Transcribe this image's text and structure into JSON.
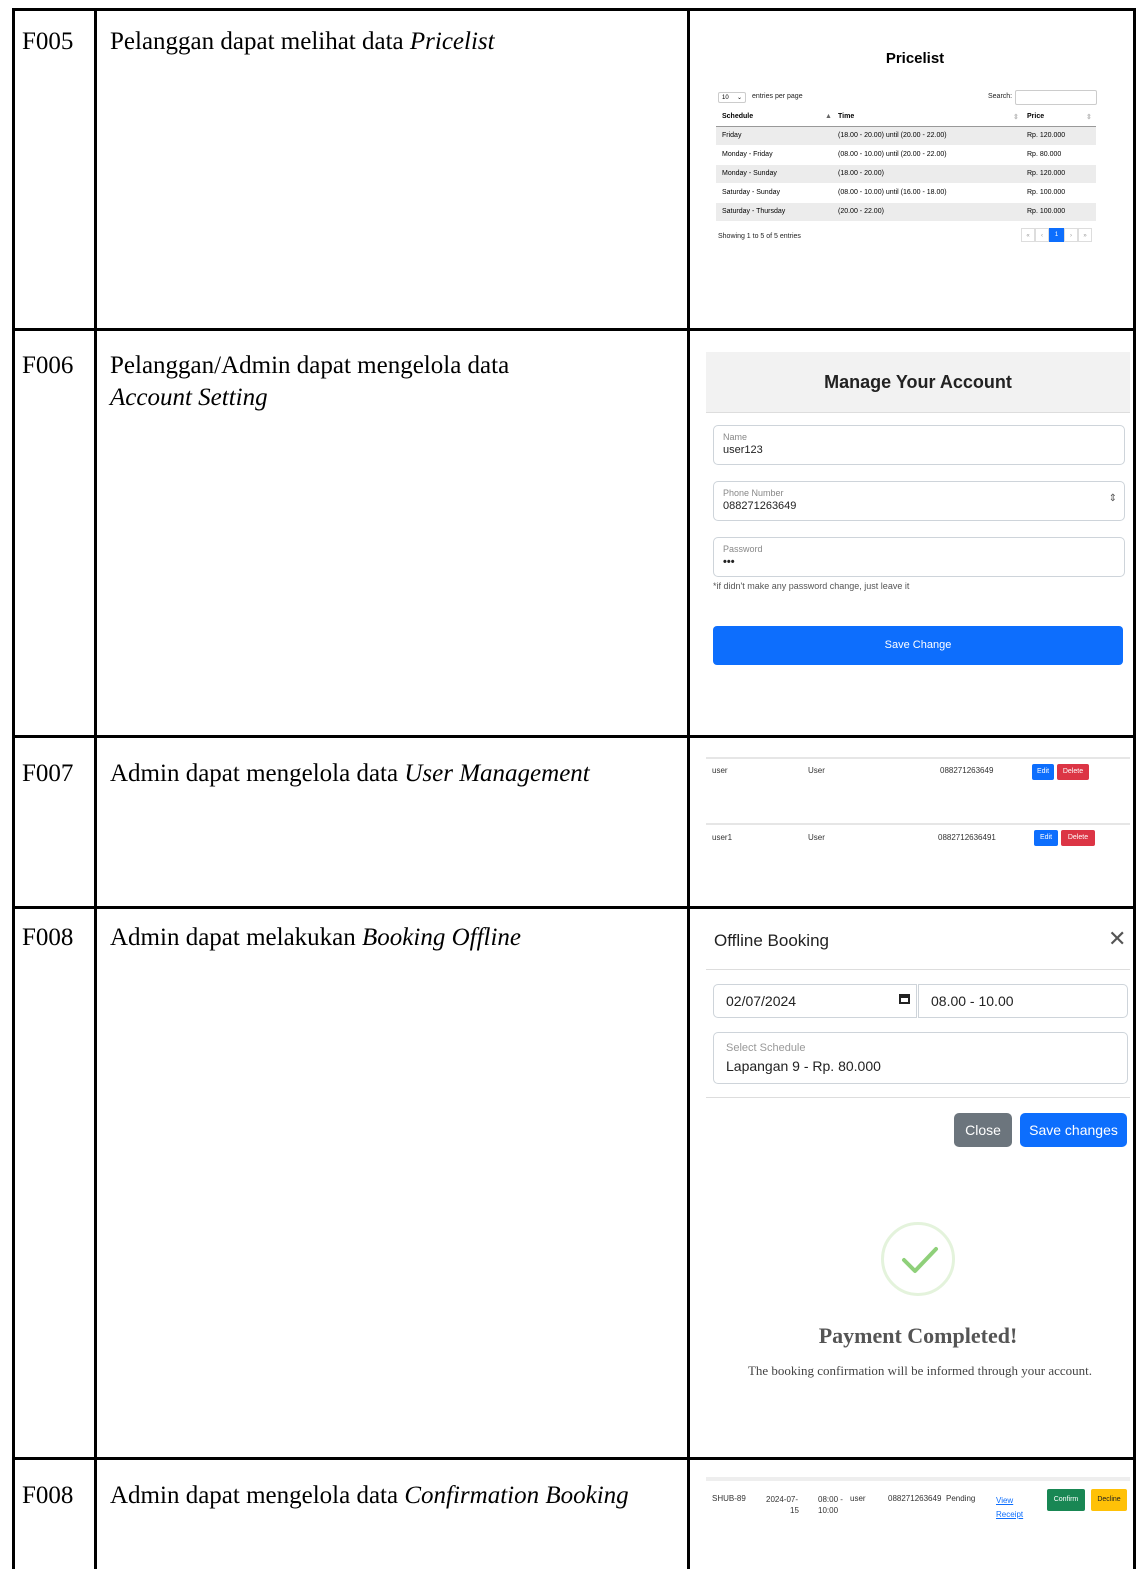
{
  "rows": [
    {
      "code": "F005",
      "desc_prefix": "Pelanggan dapat melihat data ",
      "desc_italic": "Pricelist"
    },
    {
      "code": "F006",
      "desc_prefix": "Pelanggan/Admin dapat mengelola data ",
      "desc_italic": "Account Setting"
    },
    {
      "code": "F007",
      "desc_prefix": "Admin dapat mengelola data ",
      "desc_italic": "User Management"
    },
    {
      "code": "F008",
      "desc_prefix": "Admin dapat melakukan ",
      "desc_italic": "Booking Offline"
    },
    {
      "code": "F008",
      "desc_prefix": "Admin dapat mengelola data ",
      "desc_italic": "Confirmation Booking"
    }
  ],
  "pricelist": {
    "title": "Pricelist",
    "entries_value": "10",
    "entries_label": "entries per page",
    "search_label": "Search:",
    "headers": [
      "Schedule",
      "Time",
      "Price"
    ],
    "items": [
      {
        "schedule": "Friday",
        "time": "(18.00 - 20.00) until (20.00 - 22.00)",
        "price": "Rp. 120.000"
      },
      {
        "schedule": "Monday - Friday",
        "time": "(08.00 - 10.00) until (20.00 - 22.00)",
        "price": "Rp. 80.000"
      },
      {
        "schedule": "Monday - Sunday",
        "time": "(18.00 - 20.00)",
        "price": "Rp. 120.000"
      },
      {
        "schedule": "Saturday - Sunday",
        "time": "(08.00 - 10.00) until (16.00 - 18.00)",
        "price": "Rp. 100.000"
      },
      {
        "schedule": "Saturday - Thursday",
        "time": "(20.00 - 22.00)",
        "price": "Rp. 100.000"
      }
    ],
    "footer": "Showing 1 to 5 of 5 entries",
    "page": "1"
  },
  "account": {
    "title": "Manage Your Account",
    "name_label": "Name",
    "name_value": "user123",
    "phone_label": "Phone Number",
    "phone_value": "088271263649",
    "password_label": "Password",
    "password_value": "•••",
    "hint": "*if didn't make any password change, just leave it",
    "save_label": "Save Change"
  },
  "users": [
    {
      "username": "user",
      "role": "User",
      "phone": "088271263649"
    },
    {
      "username": "user1",
      "role": "User",
      "phone": "0882712636491"
    }
  ],
  "user_actions": {
    "edit": "Edit",
    "delete": "Delete"
  },
  "offline_booking": {
    "title": "Offline Booking",
    "date_value": "02/07/2024",
    "time_value": "08.00 - 10.00",
    "schedule_label": "Select Schedule",
    "schedule_value": "Lapangan 9 - Rp. 80.000",
    "close_label": "Close",
    "save_label": "Save changes"
  },
  "payment": {
    "title": "Payment Completed!",
    "message": "The booking confirmation will be informed through your account."
  },
  "confirmation": {
    "id": "SHUB-89",
    "date_line1": "2024-07-",
    "date_line2": "15",
    "time_line1": "08:00 -",
    "time_line2": "10:00",
    "user": "user",
    "phone": "088271263649",
    "status": "Pending",
    "receipt_line1": "View",
    "receipt_line2": "Receipt",
    "confirm_label": "Confirm",
    "decline_label": "Decline"
  },
  "colors": {
    "primary": "#0d6efd",
    "danger": "#dc3545",
    "success": "#198754",
    "warning": "#ffc107",
    "secondary": "#6c757d"
  }
}
